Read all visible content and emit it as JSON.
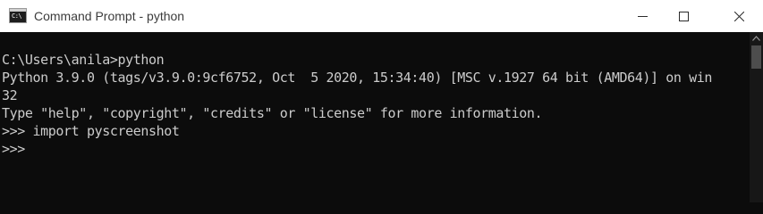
{
  "window": {
    "title": "Command Prompt - python",
    "icon": "cmd-icon",
    "icon_text": "C:\\",
    "controls": [
      "minimize-icon",
      "maximize-icon",
      "close-icon"
    ]
  },
  "console": {
    "lines": [
      "C:\\Users\\anila>python",
      "Python 3.9.0 (tags/v3.9.0:9cf6752, Oct  5 2020, 15:34:40) [MSC v.1927 64 bit (AMD64)] on win",
      "32",
      "Type \"help\", \"copyright\", \"credits\" or \"license\" for more information.",
      ">>> import pyscreenshot",
      ">>> "
    ],
    "text_color": "#cccccc",
    "background": "#0c0c0c"
  }
}
